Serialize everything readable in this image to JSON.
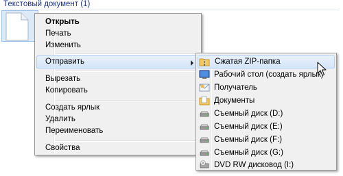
{
  "group_header": "Текстовый документ (1)",
  "context_menu": {
    "open": "Открыть",
    "print": "Печать",
    "edit": "Изменить",
    "send_to": "Отправить",
    "cut": "Вырезать",
    "copy": "Копировать",
    "create_shortcut": "Создать ярлык",
    "delete": "Удалить",
    "rename": "Переименовать",
    "properties": "Свойства"
  },
  "send_to_menu": {
    "items": [
      {
        "label": "Сжатая ZIP-папка",
        "icon": "zip-folder-icon"
      },
      {
        "label": "Рабочий стол (создать ярлык)",
        "icon": "desktop-icon"
      },
      {
        "label": "Получатель",
        "icon": "mail-recipient-icon"
      },
      {
        "label": "Документы",
        "icon": "documents-icon"
      },
      {
        "label": "Съемный диск (D:)",
        "icon": "removable-drive-icon"
      },
      {
        "label": "Съемный диск (E:)",
        "icon": "removable-drive-icon"
      },
      {
        "label": "Съемный диск (F:)",
        "icon": "removable-drive-icon"
      },
      {
        "label": "Съемный диск (G:)",
        "icon": "removable-drive-icon"
      },
      {
        "label": "DVD RW дисковод (I:)",
        "icon": "dvd-drive-icon"
      }
    ]
  },
  "colors": {
    "header_text": "#1e3287",
    "highlight_border": "#aecff7",
    "selection_bg": "#dceaf8"
  }
}
